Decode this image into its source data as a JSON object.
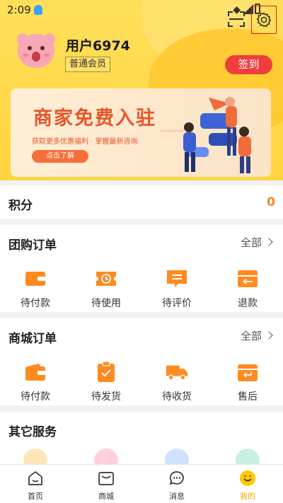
{
  "status_bar": {
    "time": "2:09"
  },
  "profile": {
    "username": "用户6974",
    "member_level": "普通会员",
    "checkin_label": "签到"
  },
  "banner": {
    "title": "商家免费入驻",
    "subtitle": "获取更多优惠福利 · 掌握最新咨询",
    "button_label": "点击了解"
  },
  "points": {
    "label": "积分",
    "value": "0"
  },
  "group_orders": {
    "title": "团购订单",
    "all_label": "全部",
    "items": [
      {
        "label": "待付款",
        "icon": "wallet-icon"
      },
      {
        "label": "待使用",
        "icon": "ticket-clock-icon"
      },
      {
        "label": "待评价",
        "icon": "comment-icon"
      },
      {
        "label": "退款",
        "icon": "refund-icon"
      }
    ]
  },
  "mall_orders": {
    "title": "商城订单",
    "all_label": "全部",
    "items": [
      {
        "label": "待付款",
        "icon": "wallet-icon"
      },
      {
        "label": "待发货",
        "icon": "clipboard-check-icon"
      },
      {
        "label": "待收货",
        "icon": "truck-icon"
      },
      {
        "label": "售后",
        "icon": "return-box-icon"
      }
    ]
  },
  "other_services": {
    "title": "其它服务"
  },
  "bottom_nav": {
    "items": [
      {
        "label": "首页",
        "icon": "home-icon"
      },
      {
        "label": "商城",
        "icon": "shopping-bag-icon"
      },
      {
        "label": "消息",
        "icon": "chat-icon"
      },
      {
        "label": "我的",
        "icon": "smiley-icon",
        "active": true
      }
    ]
  },
  "colors": {
    "header_yellow": "#ffd43f",
    "accent_orange": "#f5861f",
    "checkin_red": "#ef3d3d",
    "active_tab": "#f0a800"
  }
}
